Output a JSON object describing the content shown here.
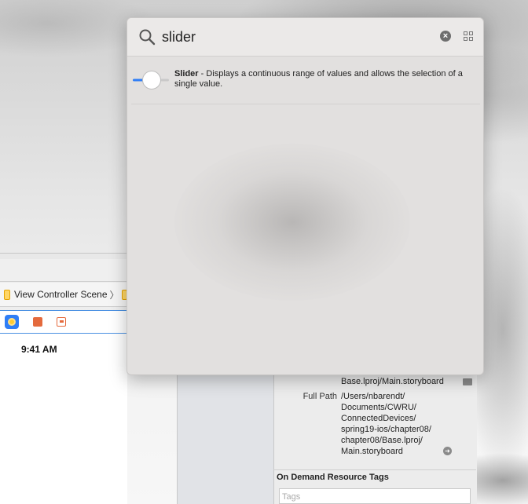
{
  "library": {
    "search": {
      "value": "slider",
      "placeholder": ""
    },
    "results": [
      {
        "title": "Slider",
        "separator": " - ",
        "description": "Displays a continuous range of values and allows the selection of a single value."
      }
    ]
  },
  "editor": {
    "jump_bar": {
      "scene_label": "View Controller Scene"
    },
    "status_time": "9:41 AM"
  },
  "inspector": {
    "location_value": "Base.lproj/Main.storyboard",
    "full_path_label": "Full Path",
    "full_path_value_lines": [
      "/Users/nbarendt/",
      "Documents/CWRU/",
      "ConnectedDevices/",
      "spring19-ios/chapter08/",
      "chapter08/Base.lproj/",
      "Main.storyboard"
    ],
    "on_demand_title": "On Demand Resource Tags",
    "tags_placeholder": "Tags"
  },
  "colors": {
    "accent": "#2f7ef6",
    "scene_icon": "#ffcc33",
    "object_icon": "#e46a3d"
  }
}
